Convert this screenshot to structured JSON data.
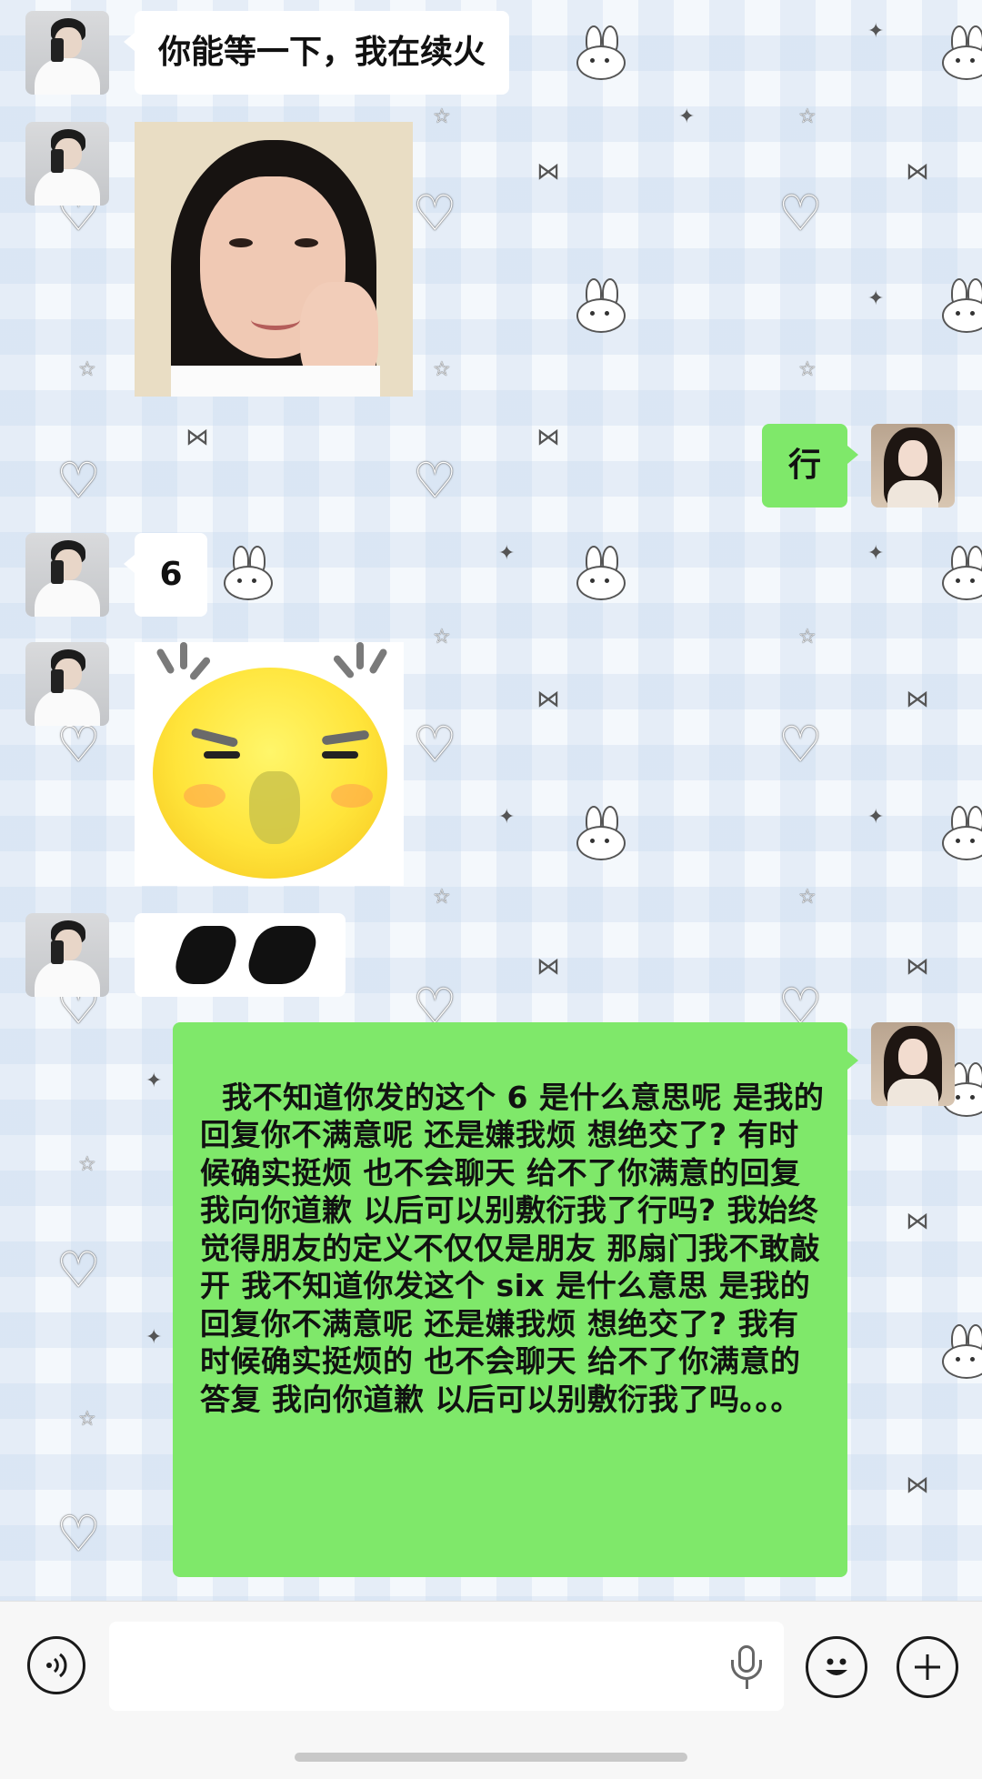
{
  "messages": {
    "m1": "你能等一下，我在续火",
    "m3": "行",
    "m4": "6",
    "m7": "我不知道你发的这个 6 是什么意思呢 是我的回复你不满意呢 还是嫌我烦 想绝交了? 有时候确实挺烦 也不会聊天 给不了你满意的回复 我向你道歉 以后可以别敷衍我了行吗? 我始终觉得朋友的定义不仅仅是朋友 那扇门我不敢敲开 我不知道你发这个 six 是什么意思 是我的回复你不满意呢 还是嫌我烦 想绝交了? 我有时候确实挺烦的 也不会聊天 给不了你满意的答复 我向你道歉 以后可以别敷衍我了吗。。。"
  },
  "icons": {
    "voice": "voice-icon",
    "emoji": "emoji-icon",
    "plus": "plus-icon",
    "mic": "mic-icon"
  },
  "colors": {
    "sent_bubble": "#7fe86a",
    "received_bubble": "#ffffff",
    "background": "#f4f8fc"
  },
  "input": {
    "value": "",
    "placeholder": ""
  }
}
